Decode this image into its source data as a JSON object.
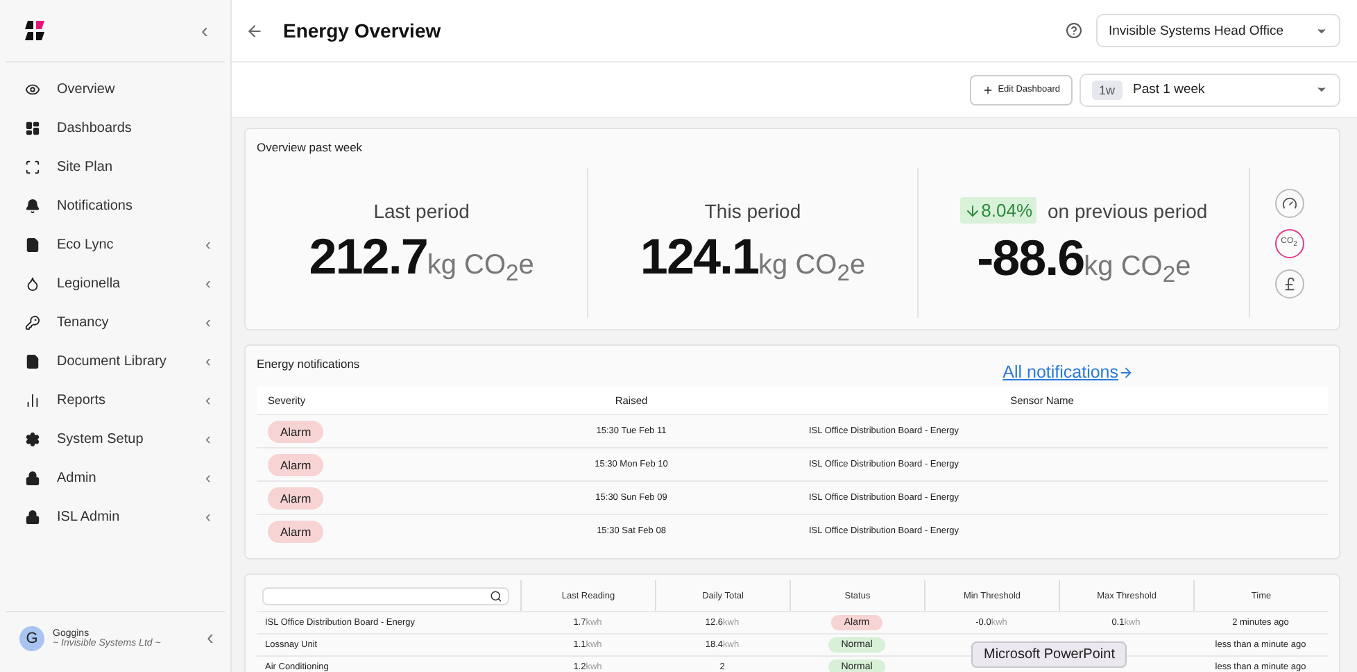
{
  "sidebar": {
    "collapse_glyph": "‹",
    "items": [
      {
        "label": "Overview",
        "expandable": false
      },
      {
        "label": "Dashboards",
        "expandable": false
      },
      {
        "label": "Site Plan",
        "expandable": false
      },
      {
        "label": "Notifications",
        "expandable": false
      },
      {
        "label": "Eco Lync",
        "expandable": true
      },
      {
        "label": "Legionella",
        "expandable": true
      },
      {
        "label": "Tenancy",
        "expandable": true
      },
      {
        "label": "Document Library",
        "expandable": true
      },
      {
        "label": "Reports",
        "expandable": true
      },
      {
        "label": "System Setup",
        "expandable": true
      },
      {
        "label": "Admin",
        "expandable": true
      },
      {
        "label": "ISL Admin",
        "expandable": true
      }
    ],
    "user": {
      "initial": "G",
      "name": "Goggins",
      "org": "~ Invisible Systems Ltd ~"
    }
  },
  "header": {
    "title": "Energy Overview",
    "site": "Invisible Systems Head Office"
  },
  "toolbar": {
    "edit_button": "Edit Dashboard",
    "period_badge": "1w",
    "period": "Past 1 week"
  },
  "overview": {
    "title": "Overview past week",
    "stats": [
      {
        "kind": "plain",
        "label": "Last period",
        "value": "212.7",
        "unit": "kg CO$_{2}$e"
      },
      {
        "kind": "plain",
        "label": "This period",
        "value": "124.1",
        "unit": "kg CO$_{2}$e"
      },
      {
        "kind": "change",
        "change": "8.04%",
        "label": "on previous period",
        "value": "-88.6",
        "unit": "kg CO$_{2}$e"
      }
    ],
    "toggles": [
      {
        "kind": "gauge",
        "selected": false
      },
      {
        "kind": "co2",
        "text": "CO$_{2}$",
        "selected": true
      },
      {
        "kind": "pound",
        "selected": false
      }
    ]
  },
  "notifications": {
    "title": "Energy notifications",
    "link": "All notifications",
    "columns": [
      "Severity",
      "Raised",
      "Sensor Name"
    ],
    "rows": [
      {
        "severity": "Alarm",
        "raised": "15:30 Tue Feb 11",
        "sensor": "ISL Office Distribution Board - Energy"
      },
      {
        "severity": "Alarm",
        "raised": "15:30 Mon Feb 10",
        "sensor": "ISL Office Distribution Board - Energy"
      },
      {
        "severity": "Alarm",
        "raised": "15:30 Sun Feb 09",
        "sensor": "ISL Office Distribution Board - Energy"
      },
      {
        "severity": "Alarm",
        "raised": "15:30 Sat Feb 08",
        "sensor": "ISL Office Distribution Board - Energy"
      }
    ]
  },
  "sensors": {
    "columns": [
      "Last Reading",
      "Daily Total",
      "Status",
      "Min Threshold",
      "Max Threshold",
      "Time"
    ],
    "rows": [
      {
        "name": "ISL Office Distribution Board - Energy",
        "last": "1.7",
        "last_unit": "kwh",
        "daily": "12.6",
        "daily_unit": "kwh",
        "status": "Alarm",
        "min": "-0.0",
        "min_unit": "kwh",
        "max": "0.1",
        "max_unit": "kwh",
        "time": "2 minutes ago"
      },
      {
        "name": "Lossnay Unit",
        "last": "1.1",
        "last_unit": "kwh",
        "daily": "18.4",
        "daily_unit": "kwh",
        "status": "Normal",
        "time": "less than a minute ago"
      },
      {
        "name": "Air Conditioning",
        "last": "1.2",
        "last_unit": "kwh",
        "daily": "2",
        "status": "Normal",
        "time": "less than a minute ago"
      }
    ]
  },
  "tooltip": "Microsoft PowerPoint"
}
